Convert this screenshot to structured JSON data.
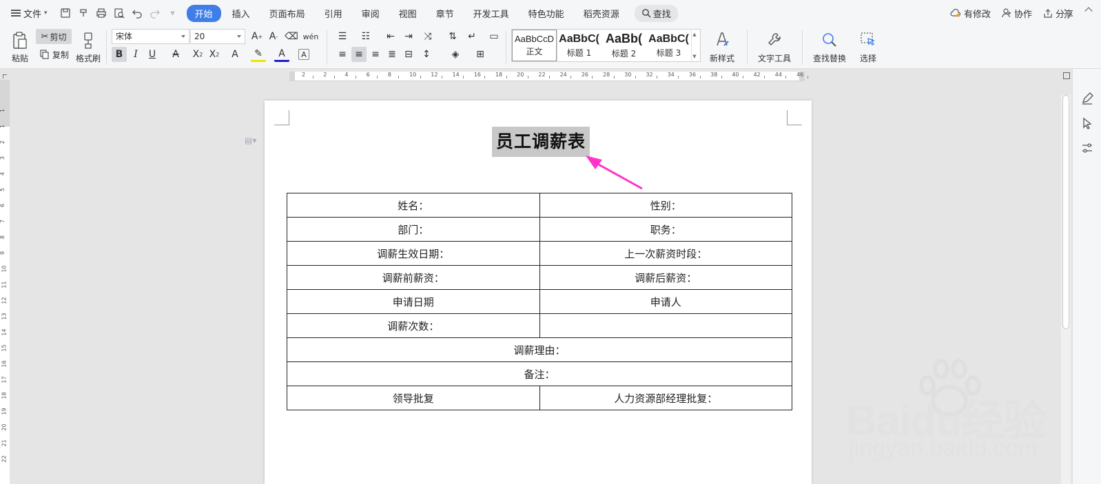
{
  "menubar": {
    "file_label": "文件",
    "tabs": [
      "开始",
      "插入",
      "页面布局",
      "引用",
      "审阅",
      "视图",
      "章节",
      "开发工具",
      "特色功能",
      "稻壳资源"
    ],
    "active_tab": "开始",
    "search_label": "查找",
    "right": {
      "changes_label": "有修改",
      "collab_label": "协作",
      "share_label": "分享"
    }
  },
  "ribbon": {
    "paste_label": "粘贴",
    "cut_label": "剪切",
    "copy_label": "复制",
    "format_painter_label": "格式刷",
    "font_name": "宋体",
    "font_size": "20",
    "styles": [
      {
        "sample": "AaBbCcD",
        "name": "正文"
      },
      {
        "sample": "AaBbC(",
        "name": "标题 1"
      },
      {
        "sample": "AaBb(",
        "name": "标题 2"
      },
      {
        "sample": "AaBbC(",
        "name": "标题 3"
      }
    ],
    "new_style_label": "新样式",
    "text_tools_label": "文字工具",
    "find_replace_label": "查找替换",
    "select_label": "选择"
  },
  "ruler": {
    "h_numbers": [
      "2",
      "2",
      "4",
      "6",
      "8",
      "10",
      "12",
      "14",
      "16",
      "18",
      "20",
      "22",
      "24",
      "26",
      "28",
      "30",
      "32",
      "34",
      "36",
      "38",
      "40",
      "42",
      "44",
      "46"
    ],
    "v_numbers": [
      "1",
      "1",
      "2",
      "3",
      "4",
      "5",
      "6",
      "7",
      "8",
      "9",
      "10",
      "11",
      "12",
      "13",
      "14",
      "15",
      "16",
      "17",
      "18",
      "19",
      "20",
      "21",
      "22"
    ]
  },
  "document": {
    "title": "员工调薪表",
    "rows": [
      [
        "姓名：",
        "性别："
      ],
      [
        "部门：",
        "职务："
      ],
      [
        "调薪生效日期：",
        "上一次薪资时段："
      ],
      [
        "调薪前薪资：",
        "调薪后薪资："
      ],
      [
        "申请日期",
        "申请人"
      ],
      [
        "调薪次数：",
        ""
      ]
    ],
    "full_rows": [
      "调薪理由：",
      "备注："
    ],
    "last_row": [
      "领导批复",
      "人力资源部经理批复："
    ]
  },
  "watermark": {
    "logo": "Baidu经验",
    "url": "jingyan.baidu.com"
  },
  "colors": {
    "accent": "#3f7ee8",
    "arrow": "#ff33cc",
    "title_highlight": "#c8c8c8"
  }
}
